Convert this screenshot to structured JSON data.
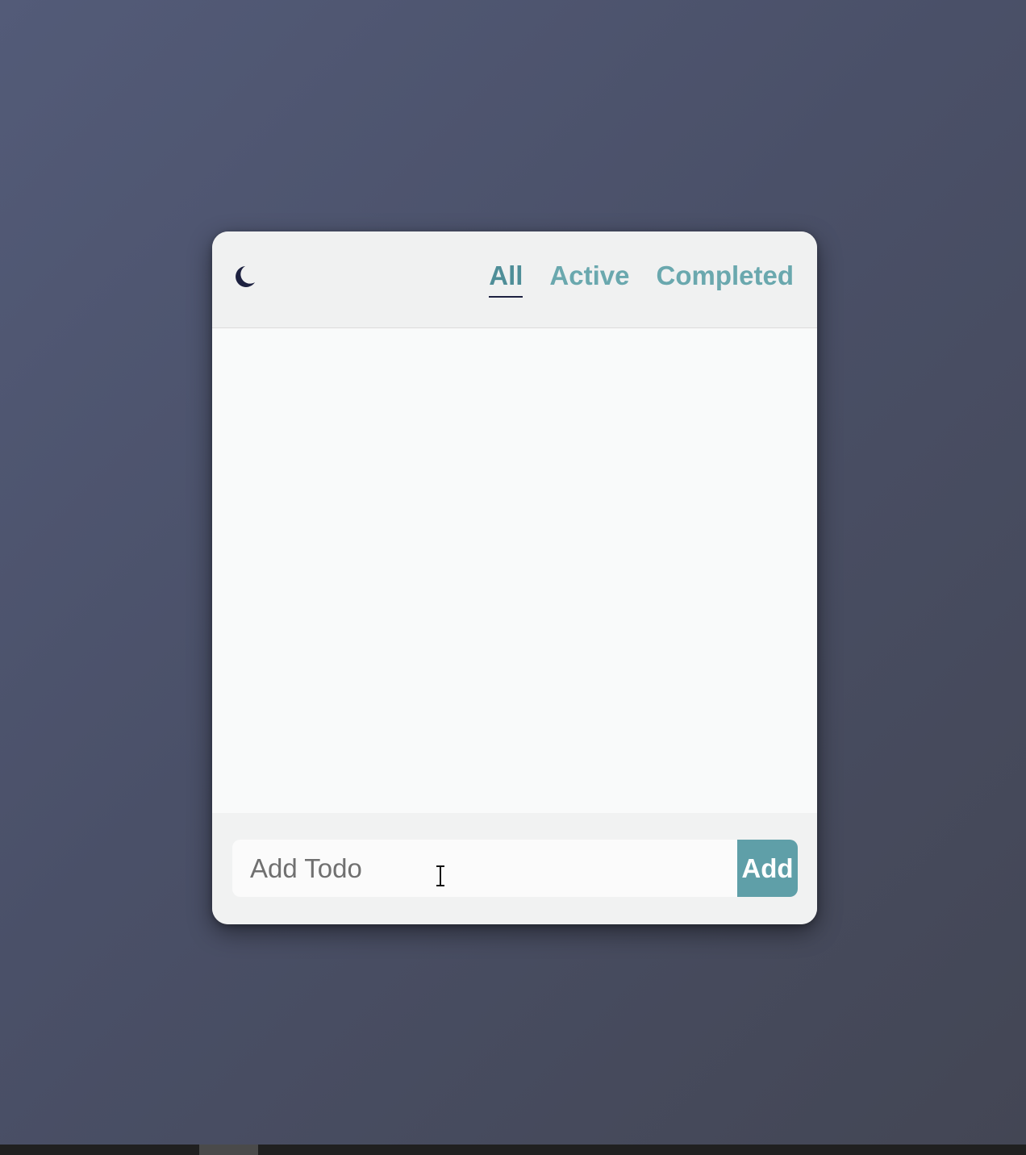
{
  "header": {
    "theme_toggle_icon": "moon-icon",
    "tabs": [
      {
        "label": "All",
        "active": true
      },
      {
        "label": "Active",
        "active": false
      },
      {
        "label": "Completed",
        "active": false
      }
    ]
  },
  "todos": [],
  "add_form": {
    "input_placeholder": "Add Todo",
    "input_value": "",
    "button_label": "Add"
  },
  "colors": {
    "accent": "#5f9fa8",
    "tab_text": "#6aa8ae",
    "active_tab_text": "#4f8e98",
    "active_underline": "#1d2140",
    "moon": "#1d2140"
  }
}
